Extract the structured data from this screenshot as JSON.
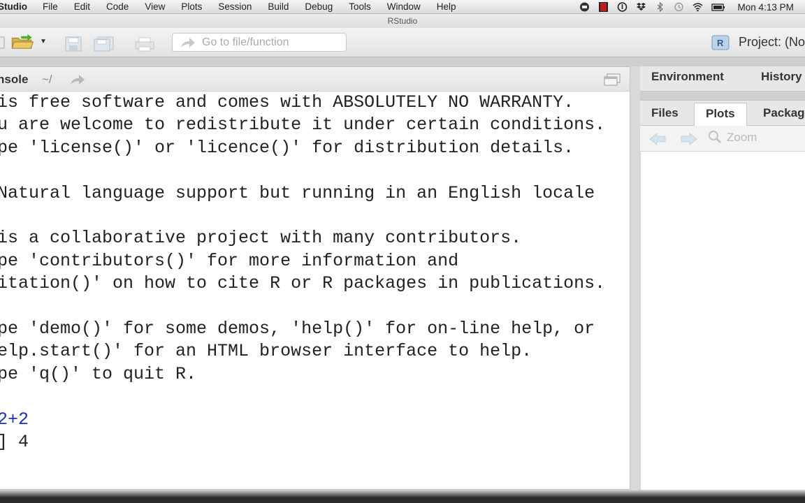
{
  "menubar": {
    "app_name": "Studio",
    "items": [
      "File",
      "Edit",
      "Code",
      "View",
      "Plots",
      "Session",
      "Build",
      "Debug",
      "Tools",
      "Window",
      "Help"
    ],
    "clock": "Mon 4:13 PM"
  },
  "window": {
    "title": "RStudio"
  },
  "toolbar": {
    "goto_placeholder": "Go to file/function",
    "project_label": "Project: (No"
  },
  "console": {
    "title": "nsole",
    "path": "~/",
    "lines": [
      {
        "text": "is free software and comes with ABSOLUTELY NO WARRANTY.",
        "kind": "output"
      },
      {
        "text": "u are welcome to redistribute it under certain conditions.",
        "kind": "output"
      },
      {
        "text": "pe 'license()' or 'licence()' for distribution details.",
        "kind": "output"
      },
      {
        "text": "",
        "kind": "output"
      },
      {
        "text": "Natural language support but running in an English locale",
        "kind": "output"
      },
      {
        "text": "",
        "kind": "output"
      },
      {
        "text": "is a collaborative project with many contributors.",
        "kind": "output"
      },
      {
        "text": "pe 'contributors()' for more information and",
        "kind": "output"
      },
      {
        "text": "itation()' on how to cite R or R packages in publications.",
        "kind": "output"
      },
      {
        "text": "",
        "kind": "output"
      },
      {
        "text": "pe 'demo()' for some demos, 'help()' for on-line help, or",
        "kind": "output"
      },
      {
        "text": "elp.start()' for an HTML browser interface to help.",
        "kind": "output"
      },
      {
        "text": "pe 'q()' to quit R.",
        "kind": "output"
      },
      {
        "text": "",
        "kind": "output"
      },
      {
        "text": "2+2",
        "kind": "input"
      },
      {
        "text": "] 4",
        "kind": "output"
      }
    ]
  },
  "env_pane": {
    "tabs": [
      "Environment",
      "History"
    ]
  },
  "files_pane": {
    "tabs": [
      "Files",
      "Plots",
      "Packag"
    ],
    "active_tab": "Plots",
    "zoom_label": "Zoom"
  }
}
